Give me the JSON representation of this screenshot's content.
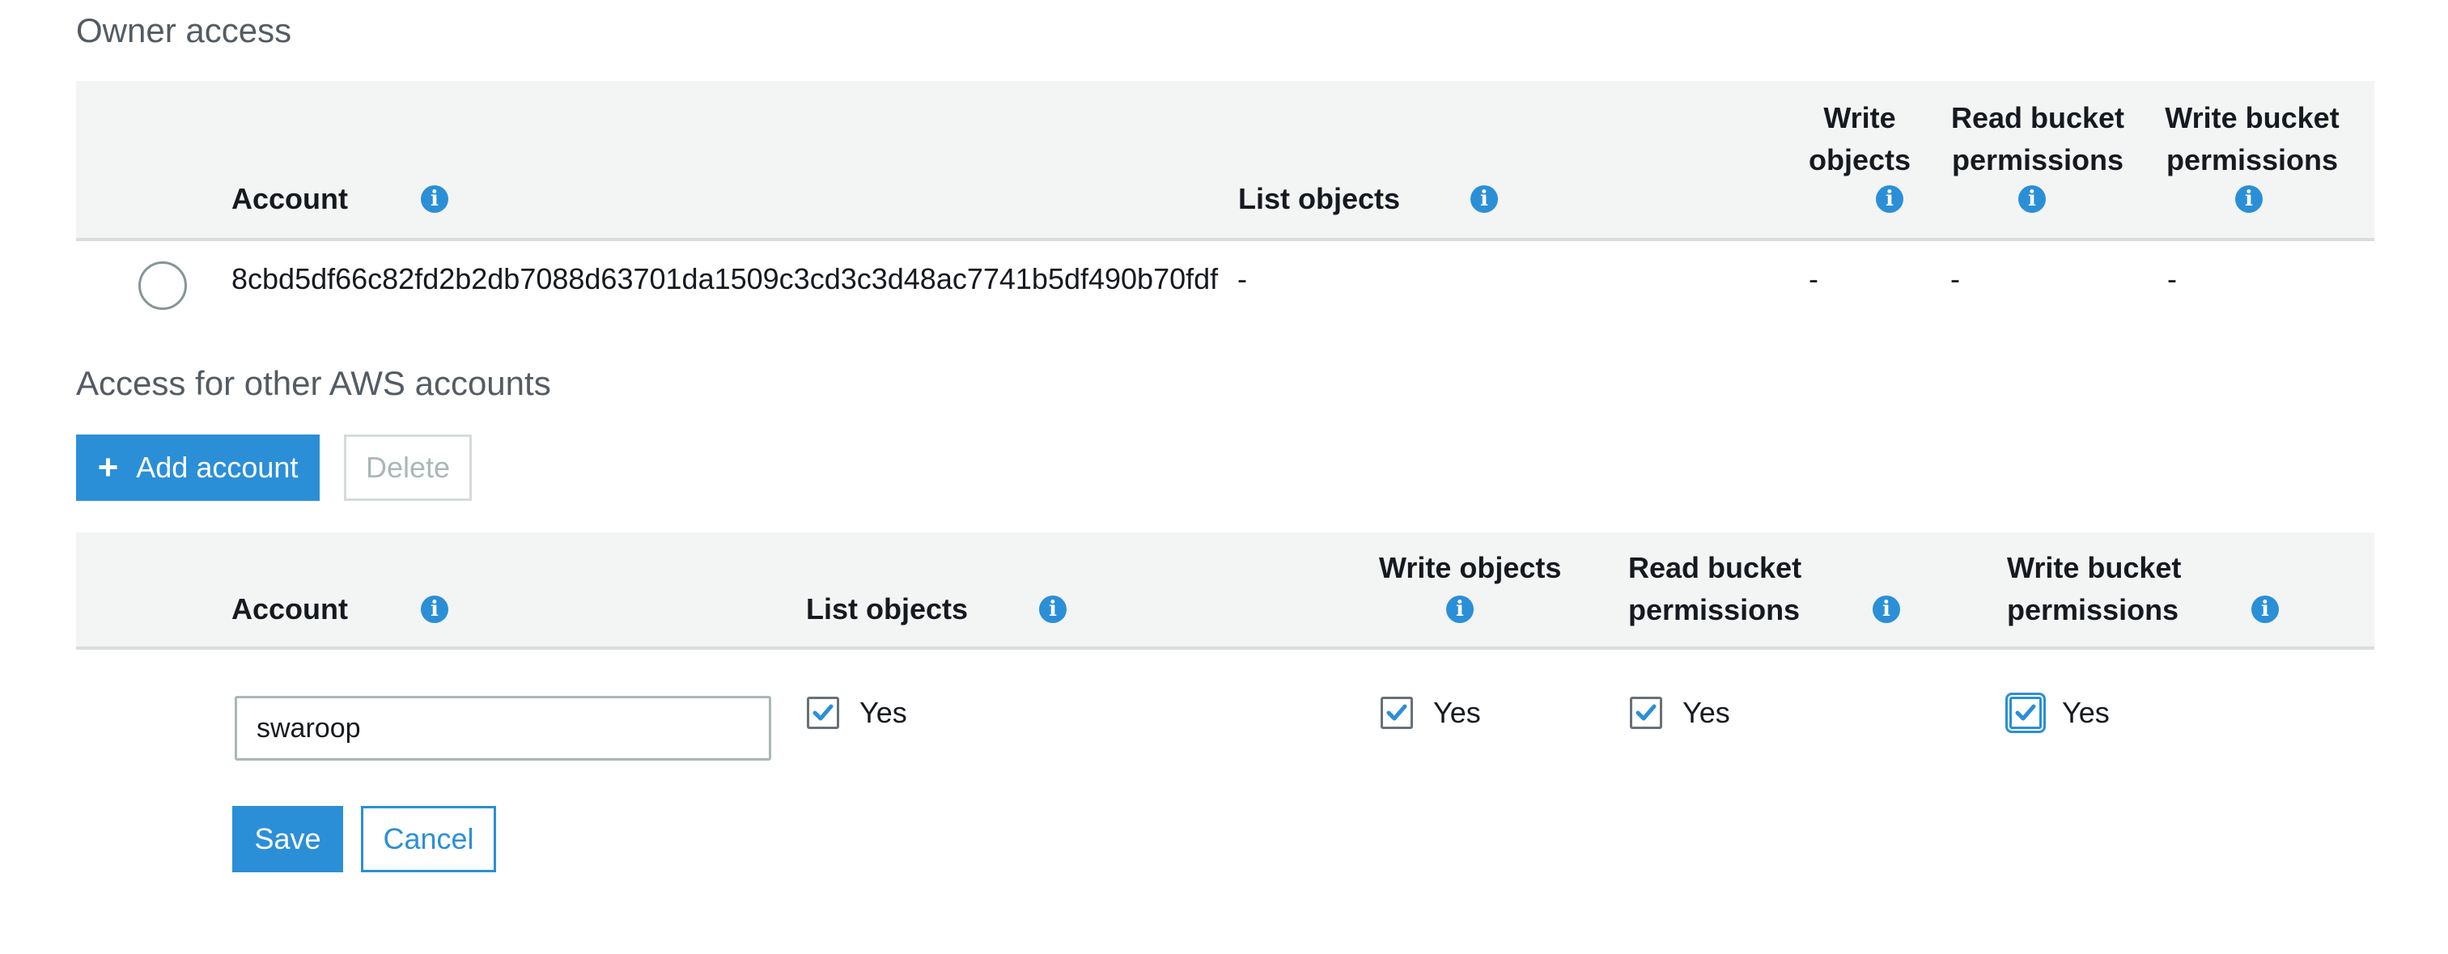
{
  "owner_section": {
    "title": "Owner access",
    "headers": {
      "account": "Account",
      "list_objects": "List objects",
      "write_objects_line1": "Write",
      "write_objects_line2": "objects",
      "read_bucket_line1": "Read bucket",
      "read_bucket_line2": "permissions",
      "write_bucket_line1": "Write bucket",
      "write_bucket_line2": "permissions"
    },
    "row": {
      "account_id": "8cbd5df66c82fd2b2db7088d63701da1509c3cd3c3d48ac7741b5df490b70fdf",
      "list_objects": "-",
      "write_objects": "-",
      "read_bucket_permissions": "-",
      "write_bucket_permissions": "-"
    }
  },
  "other_section": {
    "title": "Access for other AWS accounts",
    "add_button_label": "Add account",
    "delete_button_label": "Delete",
    "headers": {
      "account": "Account",
      "list_objects": "List objects",
      "write_objects": "Write objects",
      "read_bucket_line1": "Read bucket",
      "read_bucket_line2": "permissions",
      "write_bucket_line1": "Write bucket",
      "write_bucket_line2": "permissions"
    },
    "edit_row": {
      "account_value": "swaroop",
      "list_objects": {
        "checked": true,
        "label": "Yes"
      },
      "write_objects": {
        "checked": true,
        "label": "Yes"
      },
      "read_bucket_permissions": {
        "checked": true,
        "label": "Yes"
      },
      "write_bucket_permissions": {
        "checked": true,
        "label": "Yes"
      }
    },
    "save_label": "Save",
    "cancel_label": "Cancel"
  },
  "icons": {
    "info": "info-icon",
    "plus": "plus-icon",
    "check": "checkmark-icon"
  },
  "colors": {
    "accent": "#2b8fd7",
    "header_bg": "#f3f4f4",
    "section_title": "#545b64"
  }
}
